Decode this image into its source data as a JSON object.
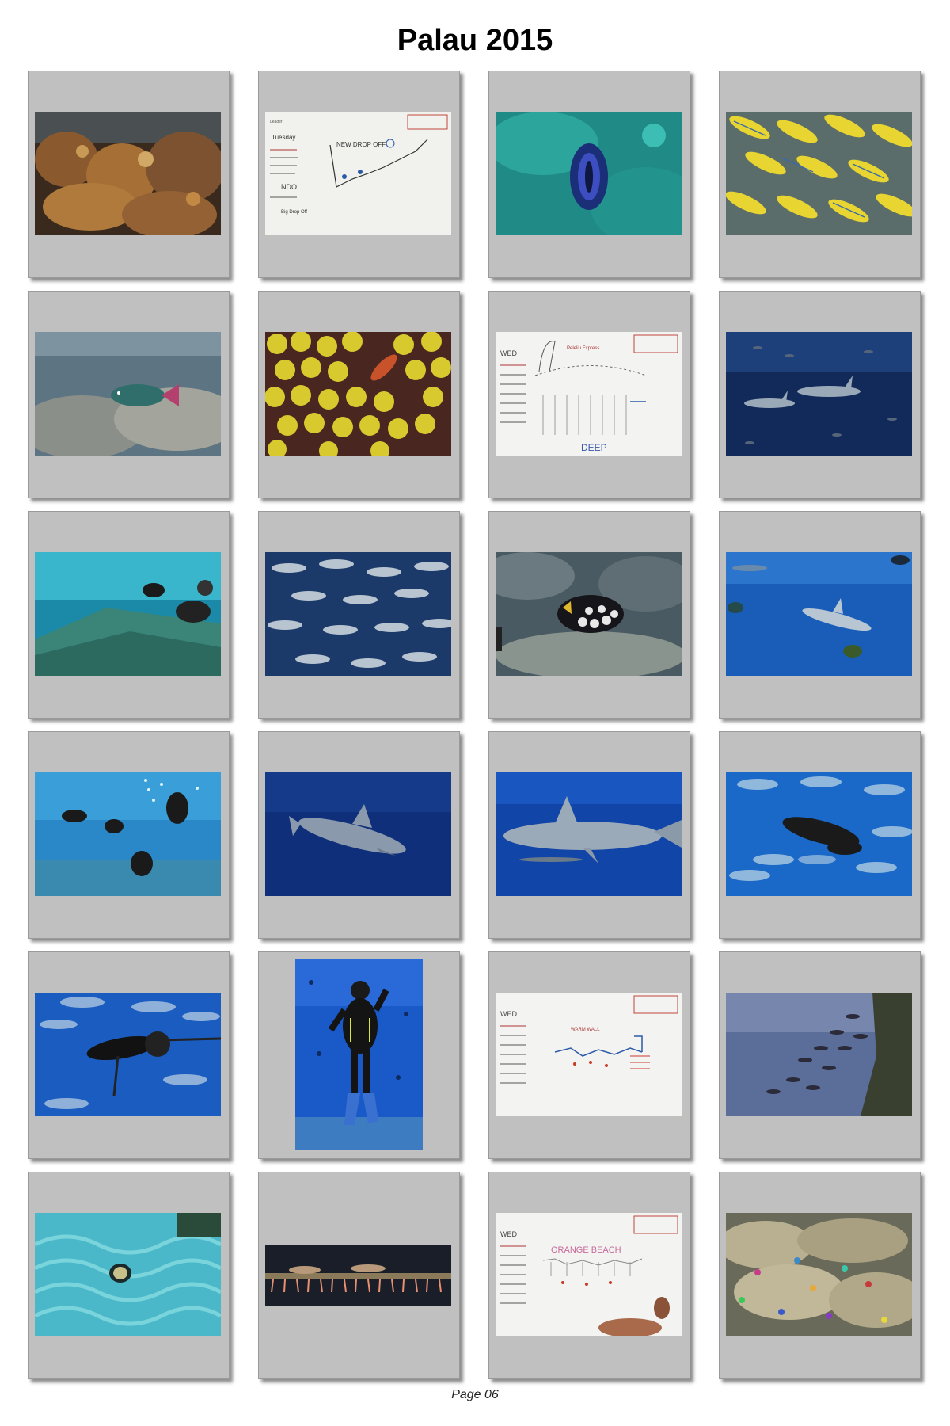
{
  "page": {
    "title": "Palau 2015",
    "footer": "Page 06"
  },
  "whiteboards": {
    "b1": {
      "day": "Tuesday",
      "site": "NEW DROP OFF",
      "note": "NDO",
      "exit": "Big Drop Off"
    },
    "b2": {
      "day": "WED",
      "site": "Peleliu Express",
      "depth": "DEEP"
    },
    "b3": {
      "day": "WED",
      "site": "WARM WALL"
    },
    "b4": {
      "day": "WED",
      "site": "ORANGE BEACH"
    }
  },
  "photos": [
    {
      "subject": "coral-reef"
    },
    {
      "subject": "dive-briefing-board"
    },
    {
      "subject": "giant-clam"
    },
    {
      "subject": "snapper-school"
    },
    {
      "subject": "parrotfish"
    },
    {
      "subject": "yellow-polyps-goby"
    },
    {
      "subject": "dive-briefing-board"
    },
    {
      "subject": "shark-school"
    },
    {
      "subject": "divers-on-slope"
    },
    {
      "subject": "jack-school"
    },
    {
      "subject": "clown-triggerfish"
    },
    {
      "subject": "shark-blue"
    },
    {
      "subject": "diver-group"
    },
    {
      "subject": "grey-reef-shark"
    },
    {
      "subject": "grey-reef-shark-close"
    },
    {
      "subject": "diver-with-fish"
    },
    {
      "subject": "diver-with-fish"
    },
    {
      "subject": "diver-portrait"
    },
    {
      "subject": "dive-briefing-board"
    },
    {
      "subject": "fish-school-wall"
    },
    {
      "subject": "blenny-in-coral"
    },
    {
      "subject": "gobies-on-whip"
    },
    {
      "subject": "dive-briefing-board"
    },
    {
      "subject": "christmas-tree-worms"
    }
  ]
}
